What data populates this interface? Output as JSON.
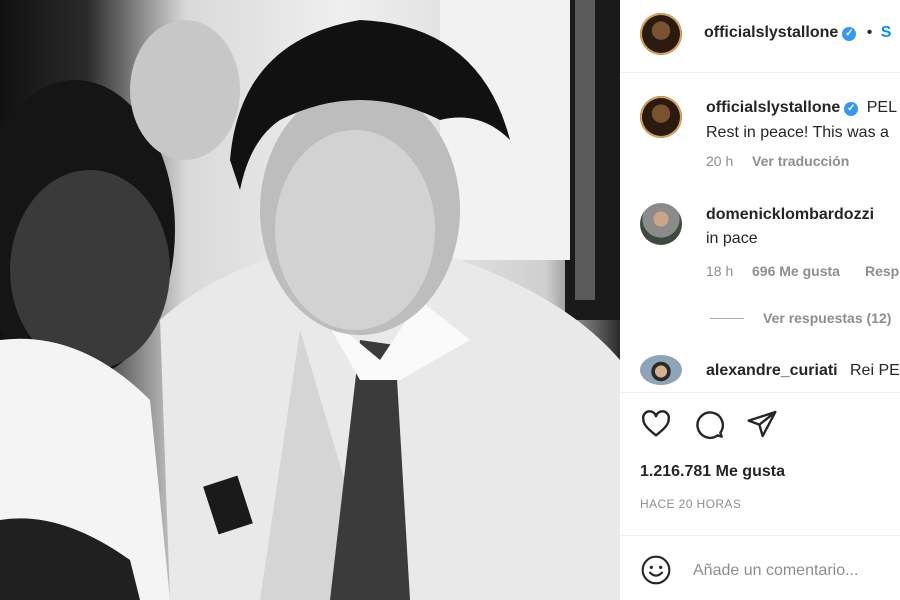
{
  "post": {
    "author": "officialslystallone",
    "follow_label": "S",
    "bullet": "•",
    "caption_author": "officialslystallone",
    "caption_prefix": "PEL",
    "caption_text": "Rest in peace! This was a",
    "caption_time": "20 h",
    "translate_label": "Ver traducción",
    "likes_count": "1.216.781 Me gusta",
    "time_ago": "HACE 20 HORAS",
    "comment_placeholder": "Añade un comentario..."
  },
  "comments": [
    {
      "user": "domenicklombardozzi",
      "text": "in pace",
      "time": "18 h",
      "likes": "696 Me gusta",
      "reply": "Respo",
      "view_replies": "Ver respuestas (12)"
    },
    {
      "user": "alexandre_curiati",
      "text": "Rei PEL"
    }
  ],
  "icons": {
    "verified": "✓",
    "like": "heart-icon",
    "comment": "comment-icon",
    "share": "share-icon",
    "emoji": "emoji-icon"
  },
  "colors": {
    "verified_blue": "#3897f0",
    "text_primary": "#262626",
    "text_secondary": "#8e8e8e"
  }
}
